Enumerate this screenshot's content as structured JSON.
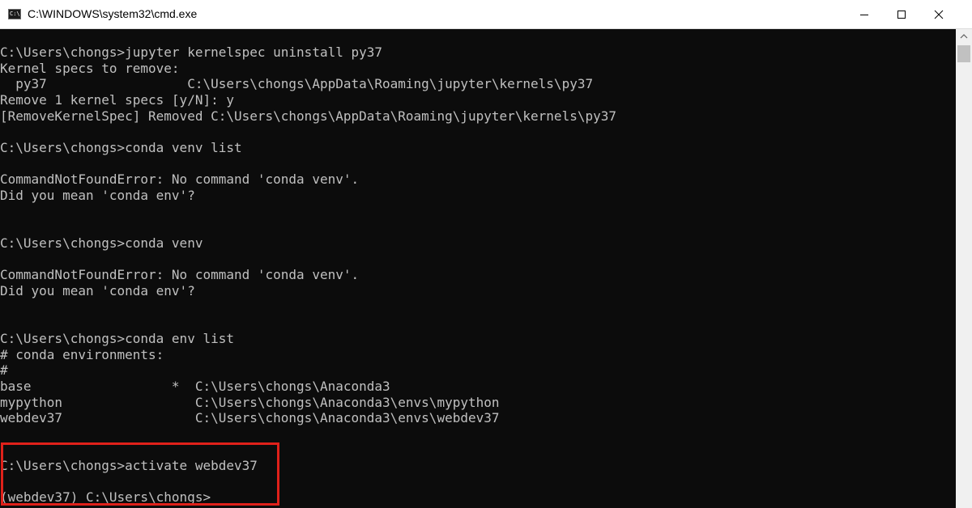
{
  "window": {
    "title": "C:\\WINDOWS\\system32\\cmd.exe",
    "app_icon": "cmd-icon",
    "controls": {
      "minimize_icon": "minimize-icon",
      "maximize_icon": "maximize-icon",
      "close_icon": "close-icon"
    }
  },
  "colors": {
    "console_background": "#0c0c0c",
    "console_text": "#c0c0c0",
    "highlight_border": "#e0211a"
  },
  "console": {
    "lines": [
      "C:\\Users\\chongs>jupyter kernelspec uninstall py37",
      "Kernel specs to remove:",
      "  py37                  C:\\Users\\chongs\\AppData\\Roaming\\jupyter\\kernels\\py37",
      "Remove 1 kernel specs [y/N]: y",
      "[RemoveKernelSpec] Removed C:\\Users\\chongs\\AppData\\Roaming\\jupyter\\kernels\\py37",
      "",
      "C:\\Users\\chongs>conda venv list",
      "",
      "CommandNotFoundError: No command 'conda venv'.",
      "Did you mean 'conda env'?",
      "",
      "",
      "C:\\Users\\chongs>conda venv",
      "",
      "CommandNotFoundError: No command 'conda venv'.",
      "Did you mean 'conda env'?",
      "",
      "",
      "C:\\Users\\chongs>conda env list",
      "# conda environments:",
      "#",
      "base                  *  C:\\Users\\chongs\\Anaconda3",
      "mypython                 C:\\Users\\chongs\\Anaconda3\\envs\\mypython",
      "webdev37                 C:\\Users\\chongs\\Anaconda3\\envs\\webdev37",
      "",
      "",
      "C:\\Users\\chongs>activate webdev37",
      "",
      "(webdev37) C:\\Users\\chongs>"
    ]
  }
}
